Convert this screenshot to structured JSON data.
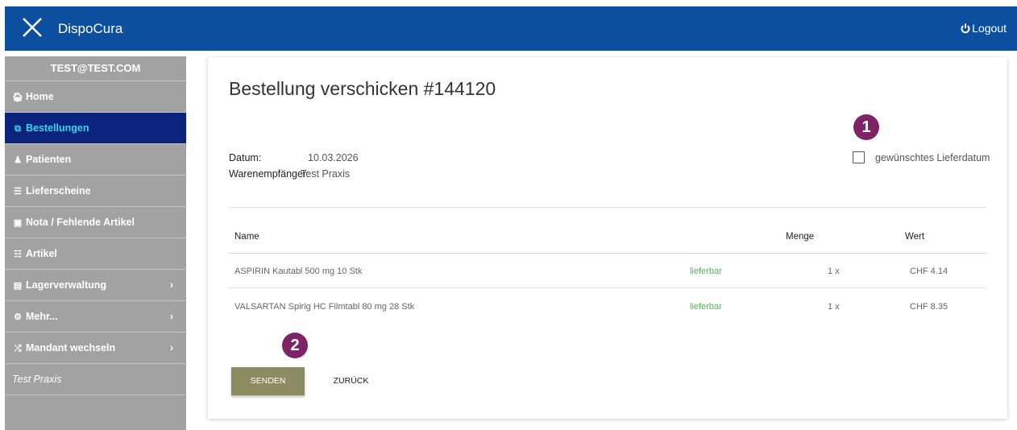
{
  "header": {
    "app_name": "DispoCura",
    "logout_label": "Logout"
  },
  "sidebar": {
    "user": "TEST@TEST.COM",
    "items": [
      {
        "label": "Home",
        "icon": "home-icon"
      },
      {
        "label": "Bestellungen",
        "icon": "orders-icon",
        "active": true
      },
      {
        "label": "Patienten",
        "icon": "users-icon"
      },
      {
        "label": "Lieferscheine",
        "icon": "document-icon"
      },
      {
        "label": "Nota / Fehlende Artikel",
        "icon": "list-box-icon"
      },
      {
        "label": "Artikel",
        "icon": "cart-icon"
      },
      {
        "label": "Lagerverwaltung",
        "icon": "archive-icon",
        "has_submenu": true
      },
      {
        "label": "Mehr...",
        "icon": "gear-icon",
        "has_submenu": true
      },
      {
        "label": "Mandant wechseln",
        "icon": "shuffle-icon",
        "has_submenu": true
      }
    ],
    "praxis": "Test Praxis"
  },
  "order": {
    "title": "Bestellung verschicken #144120",
    "date_label": "Datum:",
    "date_value": "10.03.2026",
    "recipient_label": "Warenempfänger:",
    "recipient_value": "Test Praxis",
    "wish_date_label": "gewünschtes Lieferdatum",
    "wish_date_checked": false
  },
  "badges": {
    "one": "1",
    "two": "2"
  },
  "table": {
    "headers": {
      "name": "Name",
      "menge": "Menge",
      "wert": "Wert"
    },
    "rows": [
      {
        "name": "ASPIRIN Kautabl 500 mg 10 Stk",
        "status": "lieferbar",
        "menge": "1 x",
        "wert": "CHF 4.14"
      },
      {
        "name": "VALSARTAN Spirig HC Filmtabl 80 mg 28 Stk",
        "status": "lieferbar",
        "menge": "1 x",
        "wert": "CHF 8.35"
      }
    ]
  },
  "actions": {
    "send_label": "SENDEN",
    "back_label": "ZURÜCK"
  },
  "colors": {
    "header": "#0b4f9e",
    "sidebar": "#a2a2a2",
    "active": "#0a247e",
    "badge": "#7f2366",
    "send": "#8c8c62",
    "status": "#56b356"
  }
}
